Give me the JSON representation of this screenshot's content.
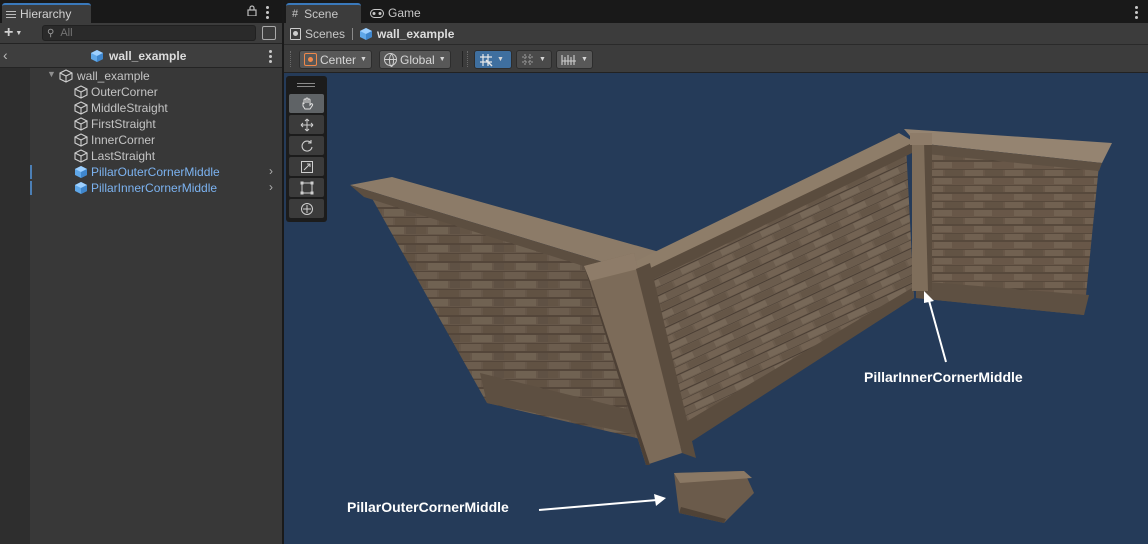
{
  "hierarchy": {
    "tab_label": "Hierarchy",
    "search_placeholder": "All",
    "scene_name": "wall_example",
    "root": {
      "label": "wall_example",
      "expanded": true
    },
    "children": [
      {
        "label": "OuterCorner",
        "icon": "gameobject-cube-icon",
        "prefab": false,
        "has_children": false
      },
      {
        "label": "MiddleStraight",
        "icon": "gameobject-cube-icon",
        "prefab": false,
        "has_children": false
      },
      {
        "label": "FirstStraight",
        "icon": "gameobject-cube-icon",
        "prefab": false,
        "has_children": false
      },
      {
        "label": "InnerCorner",
        "icon": "gameobject-cube-icon",
        "prefab": false,
        "has_children": false
      },
      {
        "label": "LastStraight",
        "icon": "gameobject-cube-icon",
        "prefab": false,
        "has_children": false
      },
      {
        "label": "PillarOuterCornerMiddle",
        "icon": "prefab-cube-icon",
        "prefab": true,
        "has_children": true
      },
      {
        "label": "PillarInnerCornerMiddle",
        "icon": "prefab-cube-icon",
        "prefab": true,
        "has_children": true
      }
    ]
  },
  "scene_view": {
    "tabs": [
      {
        "label": "Scene",
        "icon": "grid-hash-icon",
        "active": true
      },
      {
        "label": "Game",
        "icon": "gamepad-icon",
        "active": false
      }
    ],
    "breadcrumb": {
      "root": "Scenes",
      "current": "wall_example"
    },
    "toolbar": {
      "pivot_mode": "Center",
      "pivot_rotation": "Global"
    },
    "tools": [
      "hand-tool-icon",
      "move-tool-icon",
      "rotate-tool-icon",
      "scale-tool-icon",
      "rect-tool-icon",
      "transform-tool-icon"
    ],
    "active_tool": "hand-tool-icon",
    "annotations": {
      "inner_pillar_label": "PillarInnerCornerMiddle",
      "outer_pillar_label": "PillarOuterCornerMiddle"
    }
  },
  "colors": {
    "accent_blue": "#3a79bb",
    "prefab_text": "#7cb3f1",
    "viewport_bg": "#253b59",
    "pivot_orange": "#f0884a"
  }
}
